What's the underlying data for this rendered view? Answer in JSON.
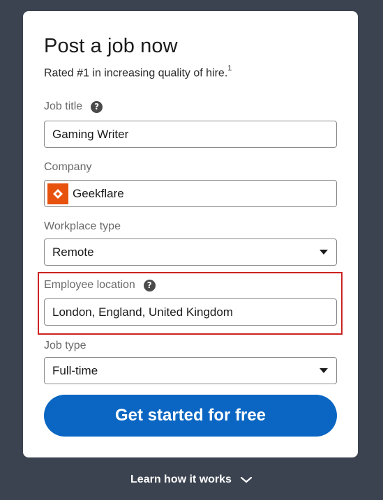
{
  "card": {
    "title": "Post a job now",
    "subtitle": "Rated #1 in increasing quality of hire.",
    "subtitle_sup": "1"
  },
  "fields": {
    "job_title": {
      "label": "Job title",
      "value": "Gaming Writer"
    },
    "company": {
      "label": "Company",
      "value": "Geekflare",
      "logo_color": "#e8520f"
    },
    "workplace_type": {
      "label": "Workplace type",
      "value": "Remote"
    },
    "employee_location": {
      "label": "Employee location",
      "value": "London, England, United Kingdom"
    },
    "job_type": {
      "label": "Job type",
      "value": "Full-time"
    }
  },
  "cta": {
    "label": "Get started for free",
    "color": "#0a66c2"
  },
  "learn": {
    "label": "Learn how it works"
  },
  "highlight_color": "#cc2222",
  "icons": {
    "help": "question-circle-icon",
    "caret": "caret-down-icon",
    "chevron": "chevron-down-icon",
    "company_logo": "geekflare-logo-icon"
  }
}
